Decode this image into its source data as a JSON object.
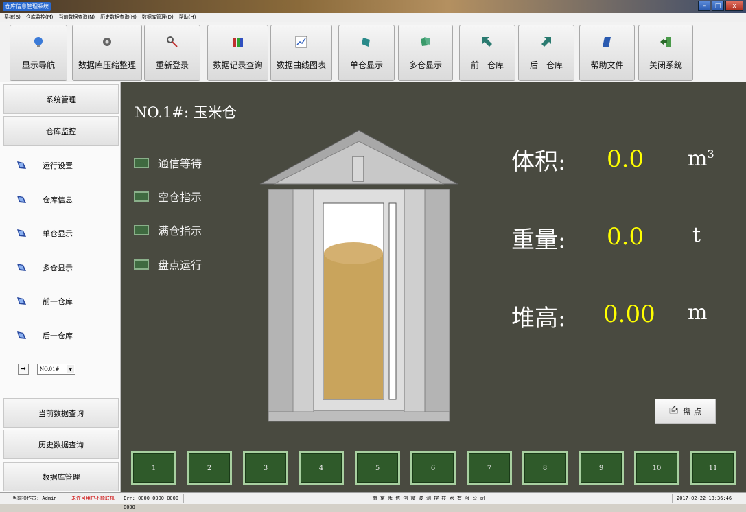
{
  "window": {
    "title": "仓库信息管理系统",
    "controls": [
      "–",
      "□",
      "x"
    ]
  },
  "menu": [
    "系统(S)",
    "仓库监控(M)",
    "当前数据查询(N)",
    "历史数据查询(H)",
    "数据库管理(D)",
    "帮助(H)"
  ],
  "toolbar": {
    "nav": "显示导航",
    "compress": "数据库压缩整理",
    "relogin": "重新登录",
    "records": "数据记录查询",
    "curve": "数据曲线图表",
    "single": "单仓显示",
    "multi": "多仓显示",
    "prev": "前一仓库",
    "next": "后一仓库",
    "help": "帮助文件",
    "close": "关闭系统"
  },
  "sidebar": {
    "system_mgmt": "系统管理",
    "monitor": "仓库监控",
    "items": [
      "运行设置",
      "仓库信息",
      "单仓显示",
      "多仓显示",
      "前一仓库",
      "后一仓库"
    ],
    "selected_bin": "NO.01#",
    "current_query": "当前数据查询",
    "history_query": "历史数据查询",
    "db_mgmt": "数据库管理"
  },
  "silo": {
    "title": "NO.1#: 玉米仓",
    "indicators": [
      "通信等待",
      "空仓指示",
      "满仓指示",
      "盘点运行"
    ],
    "fill_level": 0.75,
    "volume_label": "体积:",
    "volume_value": "0.0",
    "volume_unit": "m",
    "volume_unit_sup": "3",
    "weight_label": "重量:",
    "weight_value": "0.0",
    "weight_unit": "t",
    "height_label": "堆高:",
    "height_value": "0.00",
    "height_unit": "m",
    "check_button": "盘 点"
  },
  "bins": [
    "1",
    "2",
    "3",
    "4",
    "5",
    "6",
    "7",
    "8",
    "9",
    "10",
    "11"
  ],
  "status": {
    "operator": "当前操作员: Admin",
    "warning": "未许可用户不能联机",
    "error": "Err: 0000 0000 0000 0000",
    "company": "南 京 禾 信 创 微 波 测 控 技 术 有 限 公 司",
    "datetime": "2017-02-22 18:36:46"
  },
  "colors": {
    "panel": "#494a40",
    "value": "#ffff00",
    "led": "#3f6a40",
    "bin_button": "#2f5a2a",
    "warning": "#cc0000"
  }
}
